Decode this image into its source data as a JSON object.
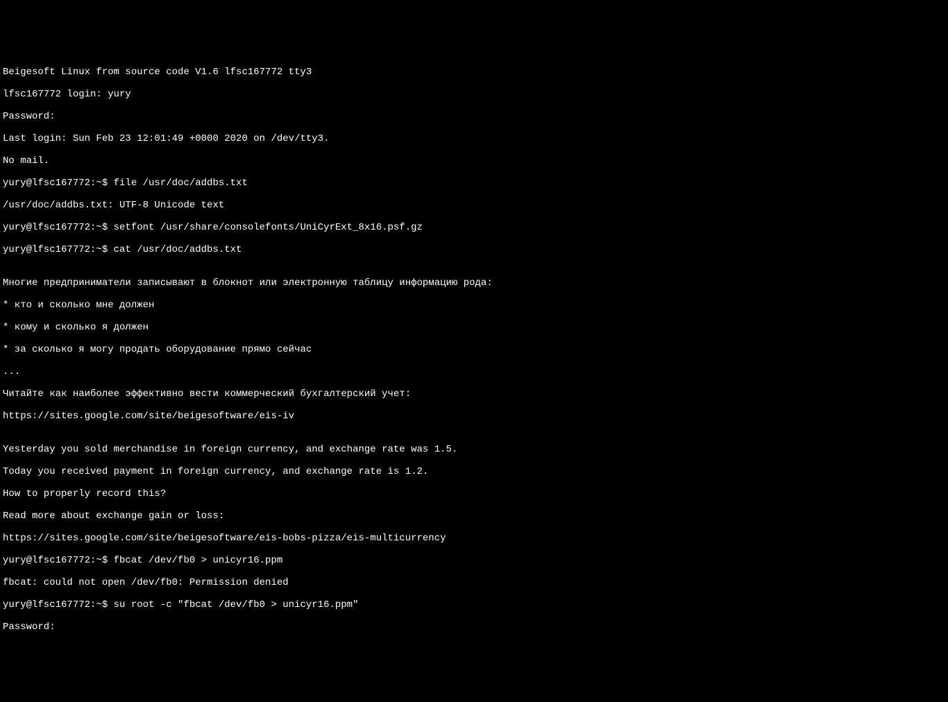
{
  "lines": [
    "Beigesoft Linux from source code V1.6 lfsc167772 tty3",
    "lfsc167772 login: yury",
    "Password:",
    "Last login: Sun Feb 23 12:01:49 +0000 2020 on /dev/tty3.",
    "No mail.",
    "yury@lfsc167772:~$ file /usr/doc/addbs.txt",
    "/usr/doc/addbs.txt: UTF-8 Unicode text",
    "yury@lfsc167772:~$ setfont /usr/share/consolefonts/UniCyrExt_8x16.psf.gz",
    "yury@lfsc167772:~$ cat /usr/doc/addbs.txt",
    "",
    "Многие предприниматели записывают в блокнот или электронную таблицу информацию рода:",
    "* кто и сколько мне должен",
    "* кому и сколько я должен",
    "* за сколько я могу продать оборудование прямо сейчас",
    "...",
    "Читайте как наиболее эффективно вести коммерческий бухгалтерский учет:",
    "https://sites.google.com/site/beigesoftware/eis-iv",
    "",
    "Yesterday you sold merchandise in foreign currency, and exchange rate was 1.5.",
    "Today you received payment in foreign currency, and exchange rate is 1.2.",
    "How to properly record this?",
    "Read more about exchange gain or loss:",
    "https://sites.google.com/site/beigesoftware/eis-bobs-pizza/eis-multicurrency",
    "yury@lfsc167772:~$ fbcat /dev/fb0 > unicyr16.ppm",
    "fbcat: could not open /dev/fb0: Permission denied",
    "yury@lfsc167772:~$ su root -c \"fbcat /dev/fb0 > unicyr16.ppm\"",
    "Password:"
  ]
}
